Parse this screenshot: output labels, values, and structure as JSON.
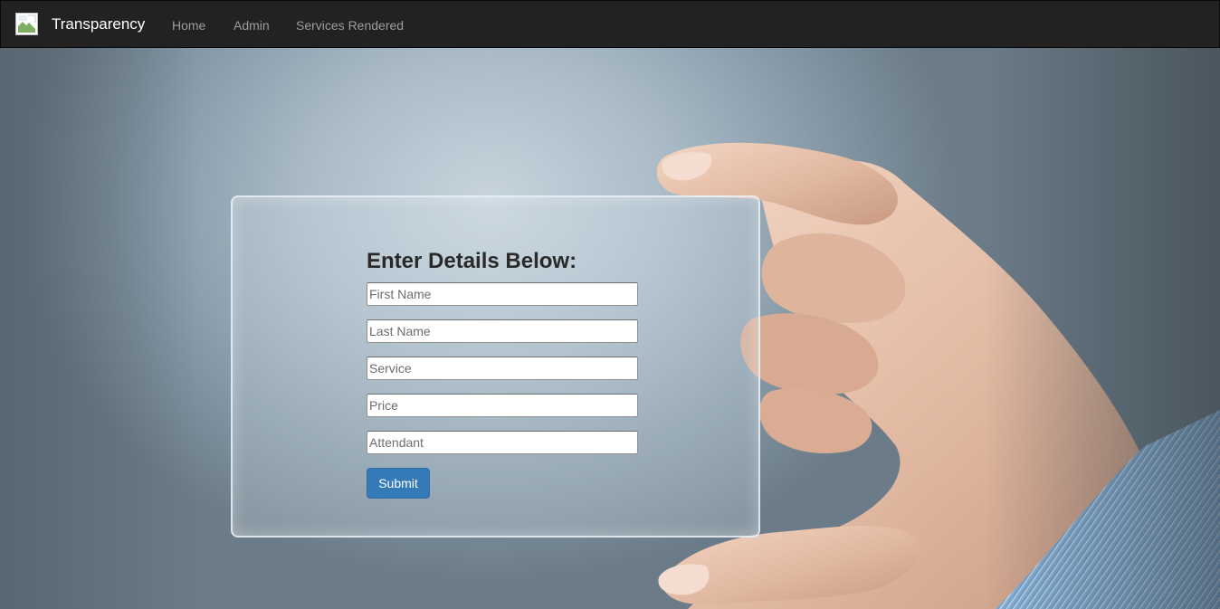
{
  "navbar": {
    "brand": "Transparency",
    "links": [
      {
        "label": "Home"
      },
      {
        "label": "Admin"
      },
      {
        "label": "Services Rendered"
      }
    ]
  },
  "form": {
    "title": "Enter Details Below:",
    "fields": [
      {
        "placeholder": "First Name",
        "value": ""
      },
      {
        "placeholder": "Last Name",
        "value": ""
      },
      {
        "placeholder": "Service",
        "value": ""
      },
      {
        "placeholder": "Price",
        "value": ""
      },
      {
        "placeholder": "Attendant",
        "value": ""
      }
    ],
    "submit_label": "Submit"
  },
  "colors": {
    "navbar_bg": "#222222",
    "brand_text": "#ffffff",
    "nav_link": "#9d9d9d",
    "button_primary": "#337ab7"
  },
  "icons": {
    "brand_logo": "broken-image-icon"
  }
}
